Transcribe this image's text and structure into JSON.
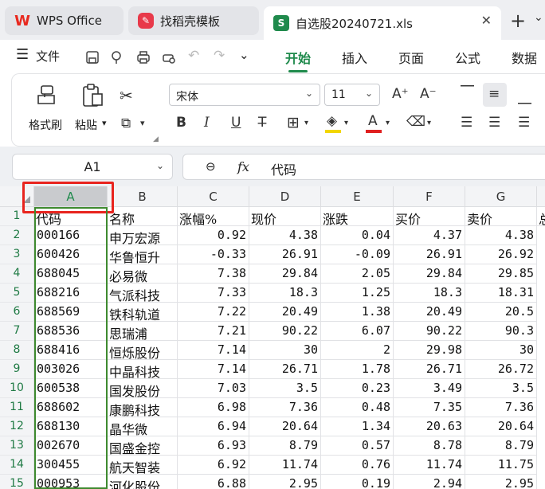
{
  "tabs": [
    {
      "label": "WPS Office",
      "icon": "wps-logo-icon",
      "color": "#e8291f"
    },
    {
      "label": "找稻壳模板",
      "icon": "docer-logo-icon",
      "color": "#e8394a"
    },
    {
      "label": "自选股20240721.xls",
      "icon": "spreadsheet-logo-icon",
      "color": "#1f8a4c",
      "badge": "S"
    }
  ],
  "menu": {
    "file": "文件",
    "items": [
      "开始",
      "插入",
      "页面",
      "公式",
      "数据"
    ],
    "active": "开始"
  },
  "ribbon": {
    "format_painter": "格式刷",
    "paste": "粘贴",
    "font_name": "宋体",
    "font_size": "11",
    "font_color": "#e02020",
    "fill_color": "#f2d600"
  },
  "formula_bar": {
    "name_box": "A1",
    "fx": "fx",
    "value": "代码"
  },
  "columns": [
    "A",
    "B",
    "C",
    "D",
    "E",
    "F",
    "G"
  ],
  "rows": [
    "1",
    "2",
    "3",
    "4",
    "5",
    "6",
    "7",
    "8",
    "9",
    "10",
    "11",
    "12",
    "13",
    "14",
    "15"
  ],
  "table": {
    "headers": [
      "代码",
      "名称",
      "涨幅%",
      "现价",
      "涨跌",
      "买价",
      "卖价",
      "总"
    ],
    "data": [
      [
        "000166",
        "申万宏源",
        "0.92",
        "4.38",
        "0.04",
        "4.37",
        "4.38"
      ],
      [
        "600426",
        "华鲁恒升",
        "-0.33",
        "26.91",
        "-0.09",
        "26.91",
        "26.92"
      ],
      [
        "688045",
        "必易微",
        "7.38",
        "29.84",
        "2.05",
        "29.84",
        "29.85"
      ],
      [
        "688216",
        "气派科技",
        "7.33",
        "18.3",
        "1.25",
        "18.3",
        "18.31"
      ],
      [
        "688569",
        "铁科轨道",
        "7.22",
        "20.49",
        "1.38",
        "20.49",
        "20.5"
      ],
      [
        "688536",
        "思瑞浦",
        "7.21",
        "90.22",
        "6.07",
        "90.22",
        "90.3"
      ],
      [
        "688416",
        "恒烁股份",
        "7.14",
        "30",
        "2",
        "29.98",
        "30"
      ],
      [
        "003026",
        "中晶科技",
        "7.14",
        "26.71",
        "1.78",
        "26.71",
        "26.72"
      ],
      [
        "600538",
        "国发股份",
        "7.03",
        "3.5",
        "0.23",
        "3.49",
        "3.5"
      ],
      [
        "688602",
        "康鹏科技",
        "6.98",
        "7.36",
        "0.48",
        "7.35",
        "7.36"
      ],
      [
        "688130",
        "晶华微",
        "6.94",
        "20.64",
        "1.34",
        "20.63",
        "20.64"
      ],
      [
        "002670",
        "国盛金控",
        "6.93",
        "8.79",
        "0.57",
        "8.78",
        "8.79"
      ],
      [
        "300455",
        "航天智装",
        "6.92",
        "11.74",
        "0.76",
        "11.74",
        "11.75"
      ],
      [
        "000953",
        "河化股份",
        "6.88",
        "2.95",
        "0.19",
        "2.94",
        "2.95"
      ]
    ]
  }
}
